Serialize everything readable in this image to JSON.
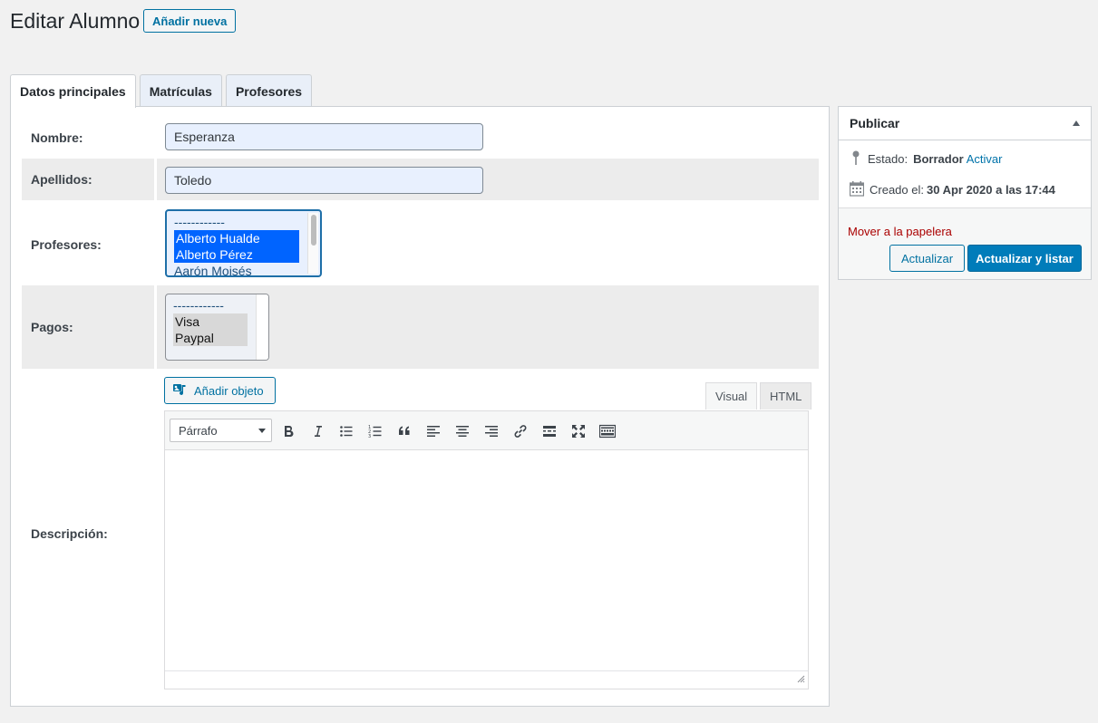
{
  "header": {
    "title": "Editar Alumno",
    "add_new_label": "Añadir nueva"
  },
  "tabs": [
    {
      "label": "Datos principales",
      "active": true
    },
    {
      "label": "Matrículas",
      "active": false
    },
    {
      "label": "Profesores",
      "active": false
    }
  ],
  "form": {
    "nombre": {
      "label": "Nombre:",
      "value": "Esperanza"
    },
    "apellidos": {
      "label": "Apellidos:",
      "value": "Toledo"
    },
    "profesores": {
      "label": "Profesores:",
      "options": [
        "------------",
        "Alberto Hualde",
        "Alberto Pérez",
        "Aarón Moisés"
      ],
      "selected": [
        "Alberto Hualde",
        "Alberto Pérez"
      ]
    },
    "pagos": {
      "label": "Pagos:",
      "options": [
        "------------",
        "Visa",
        "Paypal"
      ],
      "selected": [
        "Visa",
        "Paypal"
      ]
    },
    "descripcion": {
      "label": "Descripción:",
      "add_media_label": "Añadir objeto",
      "mode_visual": "Visual",
      "mode_html": "HTML",
      "format_select": "Párrafo",
      "toolbar_icons": [
        "bold-icon",
        "italic-icon",
        "bullet-list-icon",
        "numbered-list-icon",
        "blockquote-icon",
        "align-left-icon",
        "align-center-icon",
        "align-right-icon",
        "link-icon",
        "read-more-icon",
        "fullscreen-icon",
        "toolbar-toggle-icon"
      ],
      "content": ""
    }
  },
  "publish": {
    "title": "Publicar",
    "status_label": "Estado:",
    "status_value": "Borrador",
    "status_action": "Activar",
    "created_label": "Creado el:",
    "created_value": "30 Apr 2020 a las 17:44",
    "trash_label": "Mover a la papelera",
    "update_label": "Actualizar",
    "update_list_label": "Actualizar y listar"
  },
  "colors": {
    "accent": "#0071a1",
    "primary": "#007cba",
    "danger": "#aa0000",
    "selected_option": "#0064ff"
  }
}
